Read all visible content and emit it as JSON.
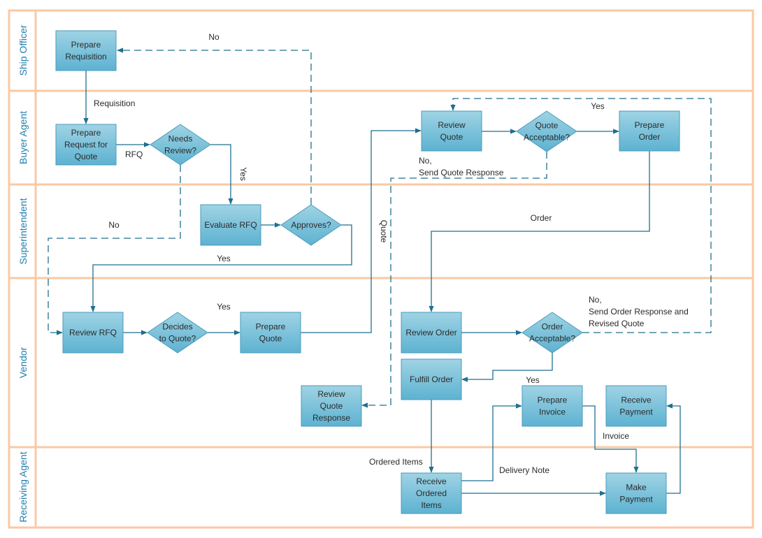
{
  "diagram": {
    "type": "cross-functional flowchart",
    "colors": {
      "lane_border": "#fbc9a3",
      "lane_label": "#1f7fae",
      "node_fill_top": "#9fd3e4",
      "node_fill_bottom": "#5db2d1",
      "node_border": "#4a9bbd",
      "connector": "#1f6f8f"
    },
    "lanes": [
      {
        "id": "ship-officer",
        "label": "Ship Officer"
      },
      {
        "id": "buyer-agent",
        "label": "Buyer Agent"
      },
      {
        "id": "superintendent",
        "label": "Superintendent"
      },
      {
        "id": "vendor",
        "label": "Vendor"
      },
      {
        "id": "receiving-agent",
        "label": "Receiving Agent"
      }
    ],
    "nodes": [
      {
        "id": "prepare-requisition",
        "shape": "process",
        "lane": "ship-officer",
        "lines": [
          "Prepare",
          "Requisition"
        ]
      },
      {
        "id": "prepare-rfq",
        "shape": "process",
        "lane": "buyer-agent",
        "lines": [
          "Prepare",
          "Request for",
          "Quote"
        ]
      },
      {
        "id": "needs-review",
        "shape": "decision",
        "lane": "buyer-agent",
        "lines": [
          "Needs",
          "Review?"
        ]
      },
      {
        "id": "evaluate-rfq",
        "shape": "process",
        "lane": "superintendent",
        "lines": [
          "Evaluate RFQ"
        ]
      },
      {
        "id": "approves",
        "shape": "decision",
        "lane": "superintendent",
        "lines": [
          "Approves?"
        ]
      },
      {
        "id": "review-rfq",
        "shape": "process",
        "lane": "vendor",
        "lines": [
          "Review RFQ"
        ]
      },
      {
        "id": "decides-to-quote",
        "shape": "decision",
        "lane": "vendor",
        "lines": [
          "Decides",
          "to Quote?"
        ]
      },
      {
        "id": "prepare-quote",
        "shape": "process",
        "lane": "vendor",
        "lines": [
          "Prepare",
          "Quote"
        ]
      },
      {
        "id": "review-quote",
        "shape": "process",
        "lane": "buyer-agent",
        "lines": [
          "Review",
          "Quote"
        ]
      },
      {
        "id": "quote-acceptable",
        "shape": "decision",
        "lane": "buyer-agent",
        "lines": [
          "Quote",
          "Acceptable?"
        ]
      },
      {
        "id": "prepare-order",
        "shape": "process",
        "lane": "buyer-agent",
        "lines": [
          "Prepare",
          "Order"
        ]
      },
      {
        "id": "review-order",
        "shape": "process",
        "lane": "vendor",
        "lines": [
          "Review Order"
        ]
      },
      {
        "id": "order-acceptable",
        "shape": "decision",
        "lane": "vendor",
        "lines": [
          "Order",
          "Acceptable?"
        ]
      },
      {
        "id": "fulfill-order",
        "shape": "process",
        "lane": "vendor",
        "lines": [
          "Fulfill Order"
        ]
      },
      {
        "id": "review-quote-response",
        "shape": "process",
        "lane": "vendor",
        "lines": [
          "Review",
          "Quote",
          "Response"
        ]
      },
      {
        "id": "prepare-invoice",
        "shape": "process",
        "lane": "vendor",
        "lines": [
          "Prepare",
          "Invoice"
        ]
      },
      {
        "id": "receive-payment",
        "shape": "process",
        "lane": "vendor",
        "lines": [
          "Receive",
          "Payment"
        ]
      },
      {
        "id": "receive-ordered-items",
        "shape": "process",
        "lane": "receiving-agent",
        "lines": [
          "Receive",
          "Ordered",
          "Items"
        ]
      },
      {
        "id": "make-payment",
        "shape": "process",
        "lane": "receiving-agent",
        "lines": [
          "Make",
          "Payment"
        ]
      }
    ],
    "edges": [
      {
        "id": "e1",
        "from": "prepare-requisition",
        "to": "prepare-rfq",
        "style": "solid"
      },
      {
        "id": "e2",
        "from": "prepare-rfq",
        "to": "needs-review",
        "style": "solid"
      },
      {
        "id": "e3",
        "from": "needs-review",
        "to": "evaluate-rfq",
        "style": "solid"
      },
      {
        "id": "e4",
        "from": "needs-review",
        "to": "review-rfq",
        "style": "dashed"
      },
      {
        "id": "e5",
        "from": "evaluate-rfq",
        "to": "approves",
        "style": "solid"
      },
      {
        "id": "e6",
        "from": "approves",
        "to": "prepare-requisition",
        "style": "dashed"
      },
      {
        "id": "e7",
        "from": "approves",
        "to": "review-rfq",
        "style": "solid"
      },
      {
        "id": "e8",
        "from": "review-rfq",
        "to": "decides-to-quote",
        "style": "solid"
      },
      {
        "id": "e9",
        "from": "decides-to-quote",
        "to": "prepare-quote",
        "style": "solid"
      },
      {
        "id": "e10",
        "from": "prepare-quote",
        "to": "review-quote",
        "style": "solid"
      },
      {
        "id": "e11",
        "from": "review-quote",
        "to": "quote-acceptable",
        "style": "solid"
      },
      {
        "id": "e12",
        "from": "quote-acceptable",
        "to": "prepare-order",
        "style": "solid"
      },
      {
        "id": "e13",
        "from": "quote-acceptable",
        "to": "review-quote-response",
        "style": "dashed"
      },
      {
        "id": "e14",
        "from": "prepare-order",
        "to": "review-order",
        "style": "solid"
      },
      {
        "id": "e15",
        "from": "review-order",
        "to": "order-acceptable",
        "style": "solid"
      },
      {
        "id": "e16",
        "from": "order-acceptable",
        "to": "review-quote",
        "style": "dashed"
      },
      {
        "id": "e17",
        "from": "order-acceptable",
        "to": "fulfill-order",
        "style": "solid"
      },
      {
        "id": "e18",
        "from": "fulfill-order",
        "to": "receive-ordered-items",
        "style": "solid"
      },
      {
        "id": "e19",
        "from": "receive-ordered-items",
        "to": "prepare-invoice",
        "style": "solid"
      },
      {
        "id": "e20",
        "from": "receive-ordered-items",
        "to": "make-payment",
        "style": "solid"
      },
      {
        "id": "e21",
        "from": "prepare-invoice",
        "to": "make-payment",
        "style": "solid"
      },
      {
        "id": "e22",
        "from": "make-payment",
        "to": "receive-payment",
        "style": "solid"
      }
    ],
    "edge_labels": {
      "no_top": "No",
      "requisition": "Requisition",
      "rfq": "RFQ",
      "yes_review": "Yes",
      "no_skip": "No",
      "yes_approve": "Yes",
      "yes_quote": "Yes",
      "quote": "Quote",
      "yes_order": "Yes",
      "no_quote_line1": "No,",
      "no_quote_line2": "Send Quote Response",
      "order": "Order",
      "no_order_line1": "No,",
      "no_order_line2": "Send Order Response and",
      "no_order_line3": "Revised Quote",
      "yes_fulfill": "Yes",
      "invoice": "Invoice",
      "ordered_items": "Ordered Items",
      "delivery_note": "Delivery Note"
    }
  }
}
